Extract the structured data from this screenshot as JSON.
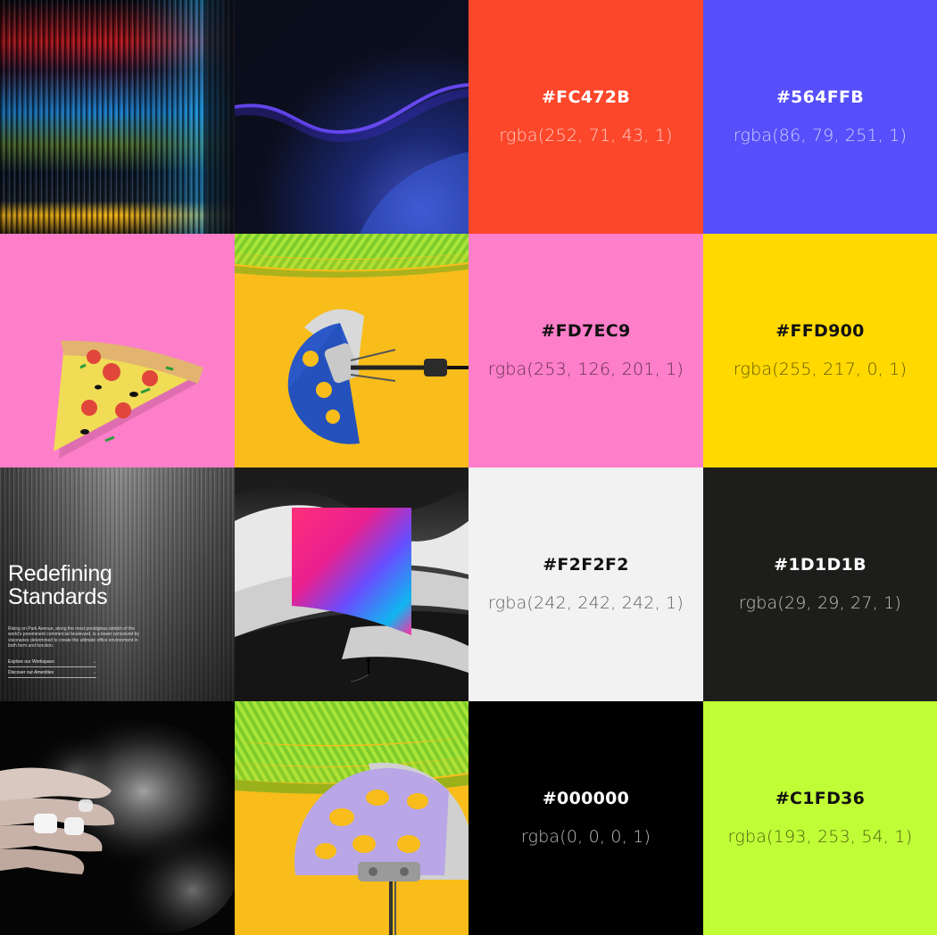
{
  "swatches": [
    {
      "hex": "#FC472B",
      "rgba": "rgba(252, 71, 43, 1)"
    },
    {
      "hex": "#564FFB",
      "rgba": "rgba(86, 79, 251, 1)"
    },
    {
      "hex": "#FD7EC9",
      "rgba": "rgba(253, 126, 201, 1)"
    },
    {
      "hex": "#FFD900",
      "rgba": "rgba(255, 217, 0, 1)"
    },
    {
      "hex": "#F2F2F2",
      "rgba": "rgba(242, 242, 242, 1)"
    },
    {
      "hex": "#1D1D1B",
      "rgba": "rgba(29, 29, 27, 1)"
    },
    {
      "hex": "#000000",
      "rgba": "rgba(0, 0, 0, 1)"
    },
    {
      "hex": "#C1FD36",
      "rgba": "rgba(193, 253, 54, 1)"
    }
  ],
  "arch_photo": {
    "title_line1": "Redefining",
    "title_line2": "Standards",
    "body": "Rising on Park Avenue, along the most prestigious stretch of the world's preeminent commercial boulevard, is a tower conceived by visionaries determined to create the ultimate office environment in both form and function.",
    "link1": "Explore our Workspace",
    "link2": "Discover our Amenities",
    "arrow": "→"
  }
}
